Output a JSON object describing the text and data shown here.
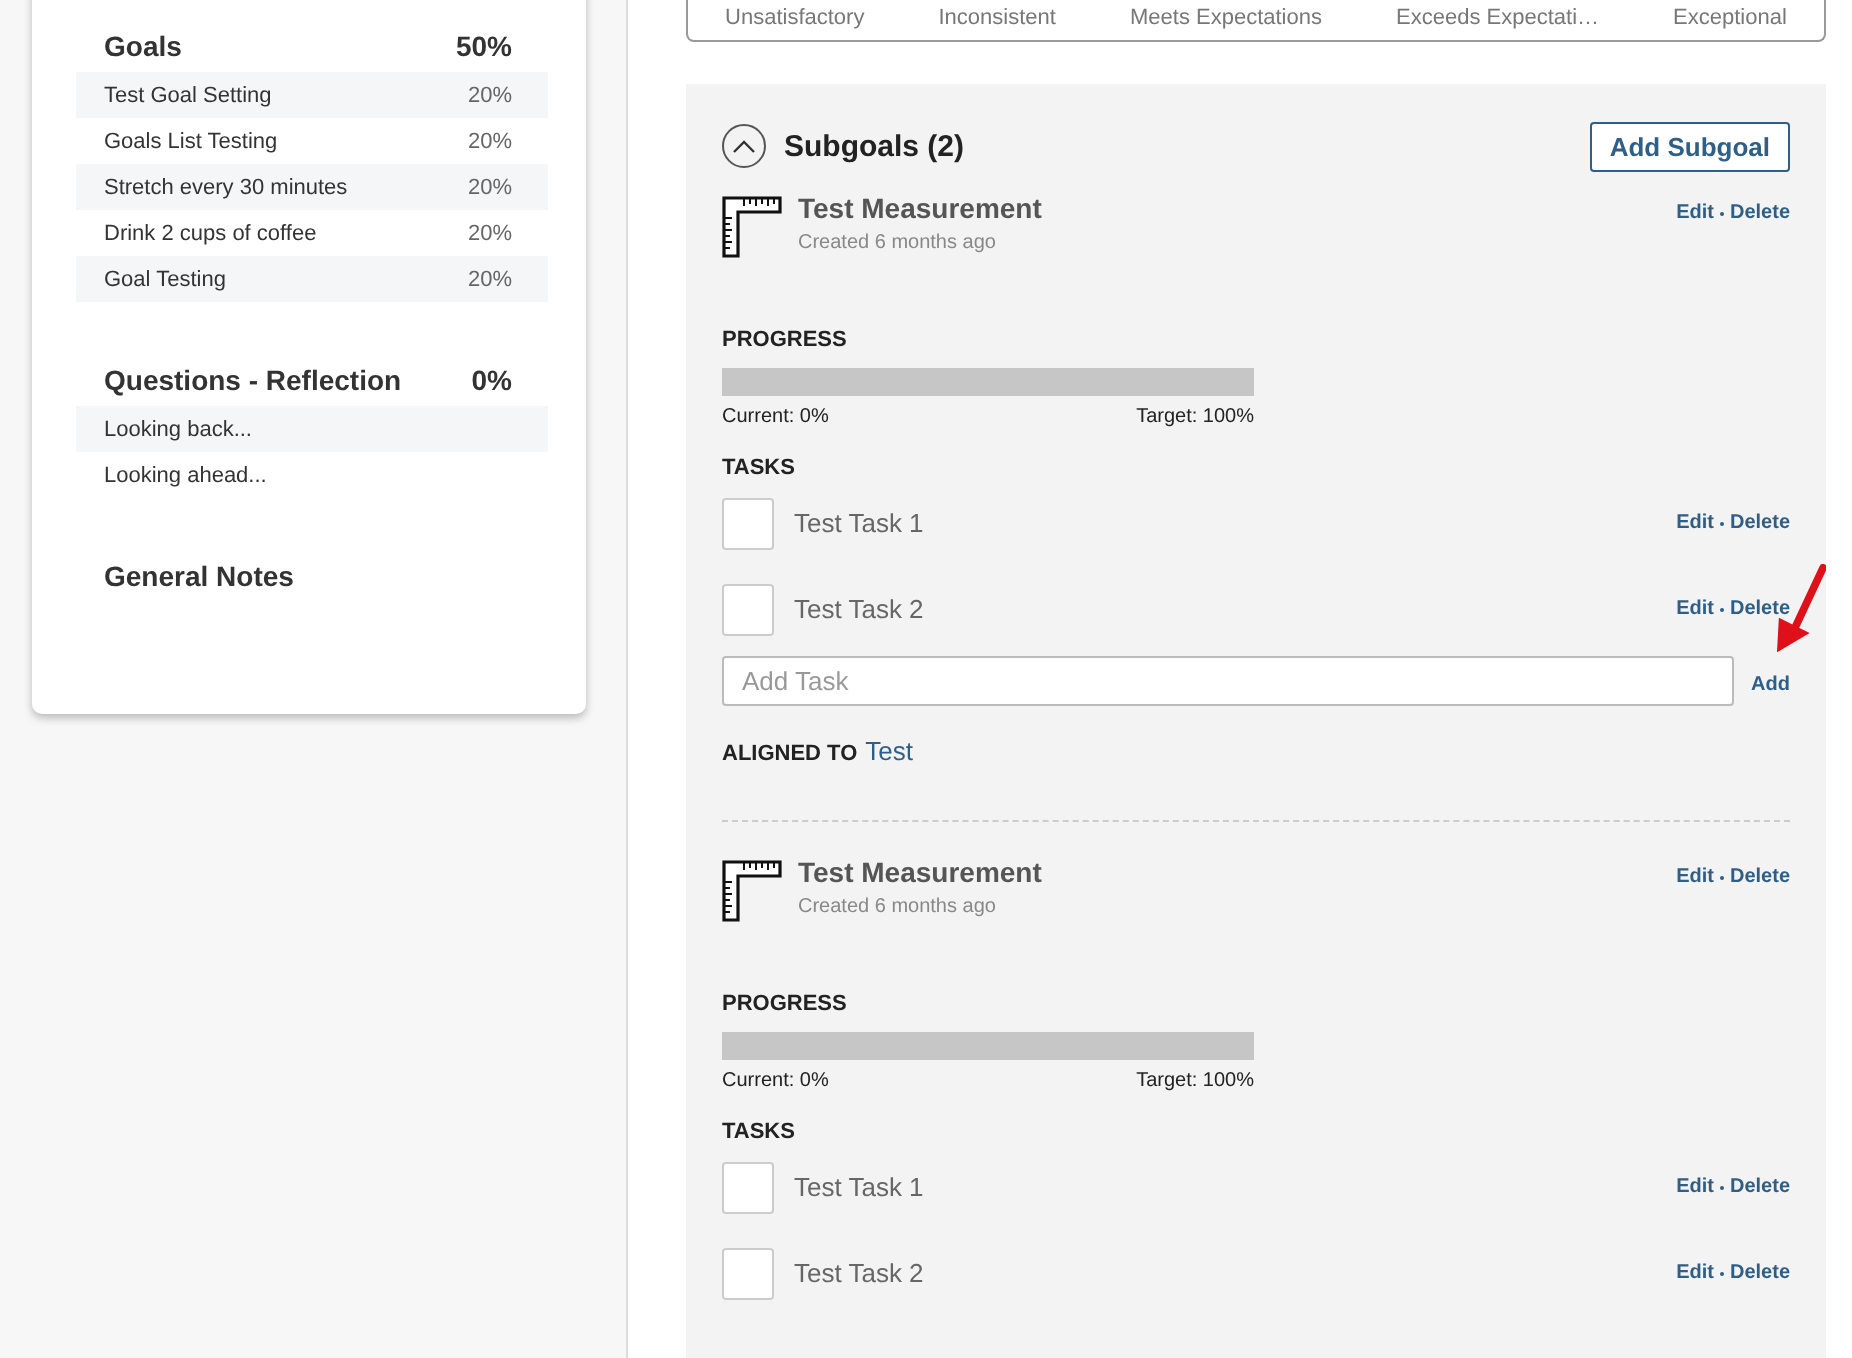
{
  "summary_card": {
    "sections": [
      {
        "title": "Goals",
        "percent": "50%",
        "items": [
          {
            "label": "Test Goal Setting",
            "percent": "20%"
          },
          {
            "label": "Goals List Testing",
            "percent": "20%"
          },
          {
            "label": "Stretch every 30 minutes",
            "percent": "20%"
          },
          {
            "label": "Drink 2 cups of coffee",
            "percent": "20%"
          },
          {
            "label": "Goal Testing",
            "percent": "20%"
          }
        ]
      },
      {
        "title": "Questions - Reflection",
        "percent": "0%",
        "items": [
          {
            "label": "Looking back..."
          },
          {
            "label": "Looking ahead..."
          }
        ]
      },
      {
        "title": "General Notes"
      }
    ]
  },
  "rating_scale": [
    "Unsatisfactory",
    "Inconsistent",
    "Meets Expectations",
    "Exceeds Expectati…",
    "Exceptional"
  ],
  "subgoals": {
    "title": "Subgoals (2)",
    "expanded": true,
    "add_button": "Add Subgoal",
    "items": [
      {
        "name": "Test Measurement",
        "created": "Created 6 months ago",
        "actions": [
          "Edit",
          "Delete"
        ],
        "progress_label": "PROGRESS",
        "level": 0,
        "current": "Current: 0%",
        "target": "Target: 100%",
        "tasks_label": "TASKS",
        "tasks": [
          {
            "label": "Test Task 1",
            "checked": false,
            "actions": [
              "Edit",
              "Delete"
            ]
          },
          {
            "label": "Test Task 2",
            "checked": false,
            "actions": [
              "Edit",
              "Delete"
            ]
          }
        ],
        "add_task": {
          "placeholder": "Add Task",
          "button": "Add"
        },
        "aligned_label": "ALIGNED TO",
        "aligned_link": "Test"
      },
      {
        "name": "Test Measurement",
        "created": "Created 6 months ago",
        "actions": [
          "Edit",
          "Delete"
        ],
        "progress_label": "PROGRESS",
        "level": 0,
        "current": "Current: 0%",
        "target": "Target: 100%",
        "tasks_label": "TASKS",
        "tasks": [
          {
            "label": "Test Task 1",
            "checked": false,
            "actions": [
              "Edit",
              "Delete"
            ]
          },
          {
            "label": "Test Task 2",
            "checked": false,
            "actions": [
              "Edit",
              "Delete"
            ]
          }
        ]
      }
    ]
  }
}
